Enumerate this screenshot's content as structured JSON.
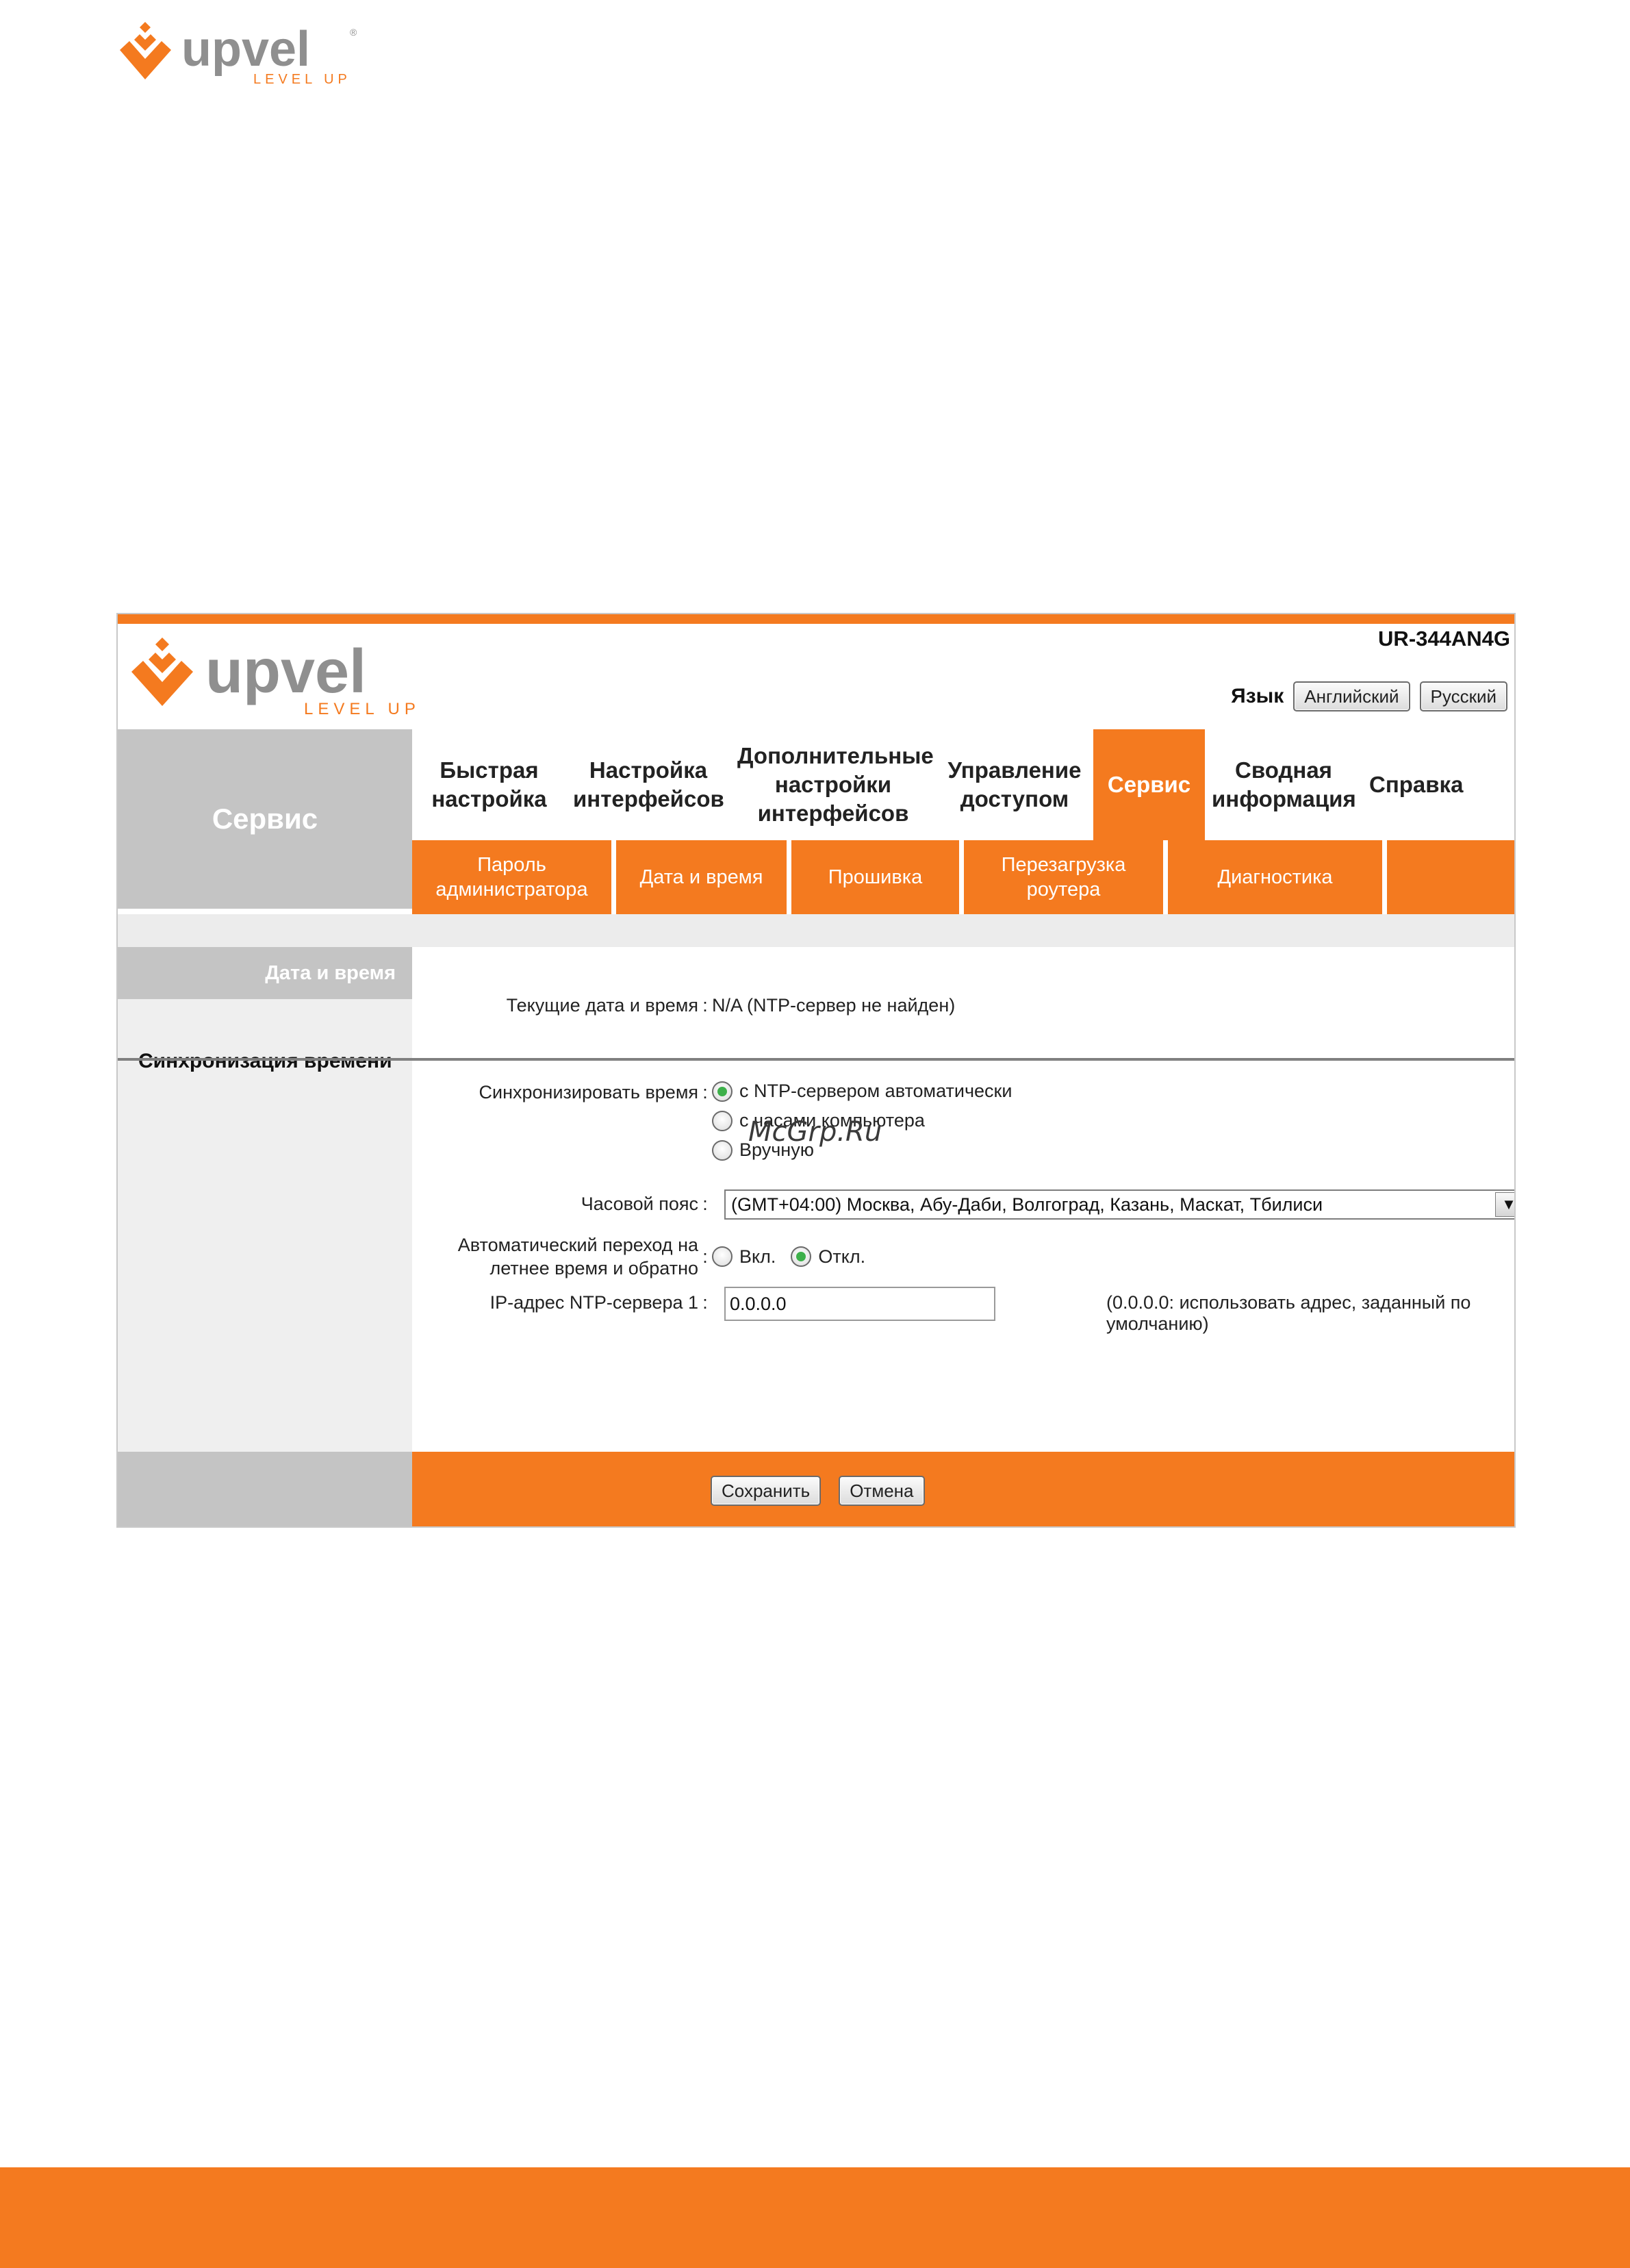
{
  "page_logo": {
    "brand": "upvel",
    "tagline": "LEVEL UP",
    "registered": "®"
  },
  "header": {
    "model": "UR-344AN4G",
    "language_label": "Язык",
    "lang_english": "Английский",
    "lang_russian": "Русский"
  },
  "section_title": "Сервис",
  "main_nav": {
    "items": [
      {
        "label": "Быстрая настройка"
      },
      {
        "label": "Настройка интерфейсов"
      },
      {
        "label": "Дополнительные настройки интерфейсов"
      },
      {
        "label": "Управление доступом"
      },
      {
        "label": "Сервис"
      },
      {
        "label": "Сводная информация"
      },
      {
        "label": "Справка"
      }
    ]
  },
  "sub_nav": {
    "items": [
      {
        "label": "Пароль администратора"
      },
      {
        "label": "Дата и время"
      },
      {
        "label": "Прошивка"
      },
      {
        "label": "Перезагрузка роутера"
      },
      {
        "label": "Диагностика"
      },
      {
        "label": ""
      }
    ]
  },
  "sidebar": {
    "heading": "Дата и время",
    "sub_heading": "Синхронизация времени"
  },
  "content": {
    "current_datetime_label": "Текущие дата и время",
    "current_datetime_value": "N/A (NTP-сервер не найден)",
    "sync_label": "Синхронизировать время",
    "sync_options": [
      "с NTP-сервером автоматически",
      "с часами компьютера",
      "Вручную"
    ],
    "sync_selected": "с NTP-сервером автоматически",
    "timezone_label": "Часовой пояс",
    "timezone_value": "(GMT+04:00) Москва, Абу-Даби, Волгоград, Казань, Маскат, Тбилиси",
    "dst_label_line1": "Автоматический переход на",
    "dst_label_line2": "летнее время и обратно",
    "dst_on": "Вкл.",
    "dst_off": "Откл.",
    "dst_selected": "Откл.",
    "ntp_label": "IP-адрес NTP-сервера 1",
    "ntp_value": "0.0.0.0",
    "ntp_hint": "(0.0.0.0: использовать адрес, заданный по умолчанию)",
    "colon": ":"
  },
  "footer": {
    "save": "Сохранить",
    "cancel": "Отмена"
  },
  "watermark": "McGrp.Ru",
  "colors": {
    "orange": "#f47a1f",
    "grey": "#c4c4c4",
    "logo_grey": "#8f8f8f"
  }
}
